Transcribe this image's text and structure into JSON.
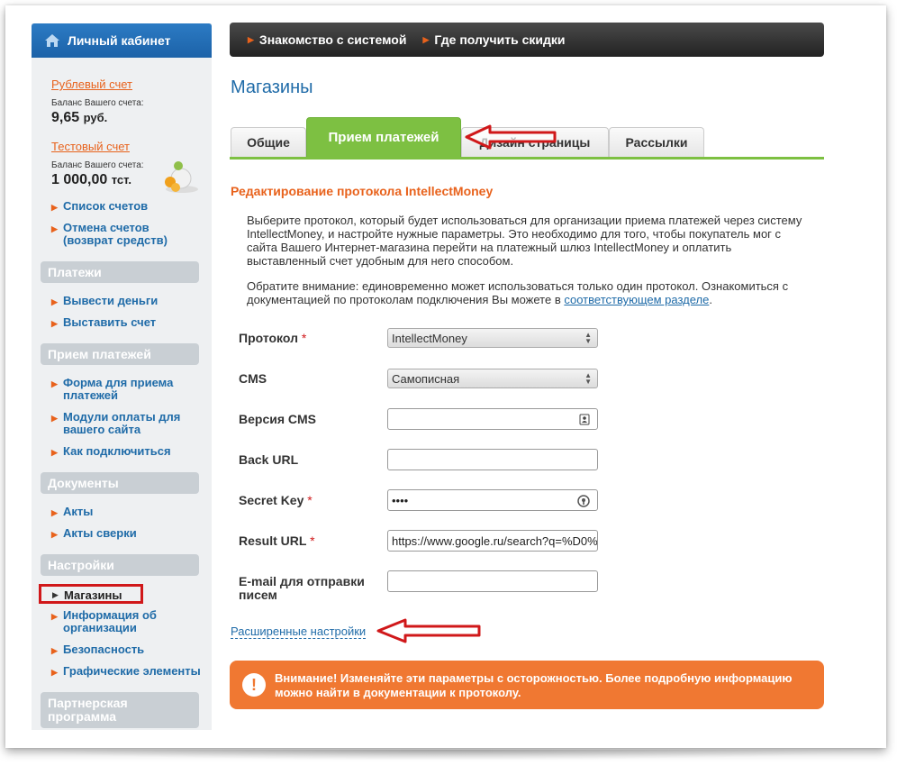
{
  "sidebar": {
    "header": "Личный кабинет",
    "ruble_account": {
      "link": "Рублевый счет",
      "note": "Баланс Вашего счета:",
      "amount": "9,65",
      "currency": "руб."
    },
    "test_account": {
      "link": "Тестовый счет",
      "note": "Баланс Вашего счета:",
      "amount": "1 000,00",
      "currency": "тст."
    },
    "links_top": [
      "Список счетов",
      "Отмена счетов (возврат средств)"
    ],
    "sections": {
      "payments": {
        "title": "Платежи",
        "items": [
          "Вывести деньги",
          "Выставить счет"
        ]
      },
      "accept": {
        "title": "Прием платежей",
        "items": [
          "Форма для приема платежей",
          "Модули оплаты для вашего сайта",
          "Как подключиться"
        ]
      },
      "documents": {
        "title": "Документы",
        "items": [
          "Акты",
          "Акты сверки"
        ]
      },
      "settings": {
        "title": "Настройки",
        "active": "Магазины",
        "items": [
          "Информация об организации",
          "Безопасность",
          "Графические элементы"
        ]
      },
      "partner": {
        "title": "Партнерская программа"
      }
    }
  },
  "topnav": [
    "Знакомство с системой",
    "Где получить скидки"
  ],
  "page_title": "Магазины",
  "tabs": [
    "Общие",
    "Прием платежей",
    "Дизайн страницы",
    "Рассылки"
  ],
  "section_title": "Редактирование протокола IntellectMoney",
  "intro": "Выберите протокол, который будет использоваться для организации приема платежей через систему IntellectMoney, и настройте нужные параметры. Это необходимо для того, чтобы покупатель мог с сайта Вашего Интернет-магазина перейти на платежный шлюз IntellectMoney и оплатить выставленный счет удобным для него способом.",
  "notice": {
    "text": "Обратите внимание: единовременно может использоваться только один протокол. Ознакомиться с документацией по протоколам подключения Вы можете в",
    "link": "соответствующем разделе",
    "end": "."
  },
  "form": {
    "protocol": {
      "label": "Протокол",
      "value": "IntellectMoney"
    },
    "cms": {
      "label": "CMS",
      "value": "Самописная"
    },
    "cms_version": {
      "label": "Версия CMS",
      "value": ""
    },
    "back_url": {
      "label": "Back URL",
      "value": ""
    },
    "secret_key": {
      "label": "Secret Key",
      "value": "••••"
    },
    "result_url": {
      "label": "Result URL",
      "value": "https://www.google.ru/search?q=%D0%"
    },
    "email": {
      "label": "E-mail для отправки писем",
      "value": ""
    },
    "required_mark": "*"
  },
  "advanced_link": "Расширенные настройки",
  "warning": {
    "icon": "!",
    "text": "Внимание! Изменяйте эти параметры с осторожностью. Более подробную информацию можно найти в документации к протоколу."
  },
  "colors": {
    "accent_blue": "#1f6ba8",
    "accent_orange": "#e8621c",
    "tab_green": "#7dc042",
    "annotation_red": "#d0181a",
    "warning_bg": "#f07832"
  }
}
